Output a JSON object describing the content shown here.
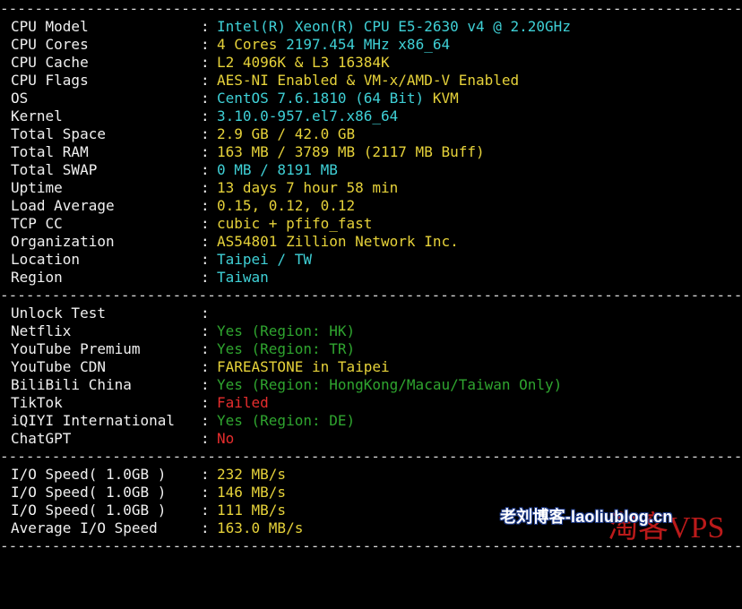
{
  "separator": "----------------------------------------------------------------------------------------------------------",
  "system_info": [
    {
      "key": "CPU Model",
      "value": "Intel(R) Xeon(R) CPU E5-2630 v4 @ 2.20GHz",
      "color": "#3fd0d6"
    },
    {
      "key": "CPU Cores",
      "value": "4 Cores 2197.454 MHz x86_64",
      "color": "#e6d23a",
      "value2": " 2197.454 MHz x86_64",
      "color2": "#3fd0d6"
    },
    {
      "key": "CPU Cache",
      "value": "L2 4096K & L3 16384K",
      "color": "#e6d23a"
    },
    {
      "key": "CPU Flags",
      "value": "AES-NI Enabled & VM-x/AMD-V Enabled",
      "color": "#e6d23a"
    },
    {
      "key": "OS",
      "value": "CentOS 7.6.1810 (64 Bit) KVM",
      "color": "#3fd0d6"
    },
    {
      "key": "Kernel",
      "value": "3.10.0-957.el7.x86_64",
      "color": "#3fd0d6"
    },
    {
      "key": "Total Space",
      "value": "2.9 GB / 42.0 GB",
      "color": "#e6d23a"
    },
    {
      "key": "Total RAM",
      "value": "163 MB / 3789 MB (2117 MB Buff)",
      "color": "#e6d23a"
    },
    {
      "key": "Total SWAP",
      "value": "0 MB / 8191 MB",
      "color": "#3fd0d6"
    },
    {
      "key": "Uptime",
      "value": "13 days 7 hour 58 min",
      "color": "#e6d23a"
    },
    {
      "key": "Load Average",
      "value": "0.15, 0.12, 0.12",
      "color": "#e6d23a"
    },
    {
      "key": "TCP CC",
      "value": "cubic + pfifo_fast",
      "color": "#e6d23a"
    },
    {
      "key": "Organization",
      "value": "AS54801 Zillion Network Inc.",
      "color": "#e6d23a"
    },
    {
      "key": "Location",
      "value": "Taipei / TW",
      "color": "#3fd0d6"
    },
    {
      "key": "Region",
      "value": "Taiwan",
      "color": "#3fd0d6"
    }
  ],
  "unlock_test": [
    {
      "key": "Unlock Test",
      "value": "",
      "color": "#f0f0f0"
    },
    {
      "key": "Netflix",
      "value": "Yes (Region: HK)",
      "color": "#2fa52f"
    },
    {
      "key": "YouTube Premium",
      "value": "Yes (Region: TR)",
      "color": "#2fa52f"
    },
    {
      "key": "YouTube CDN",
      "value": "FAREASTONE in Taipei",
      "color": "#e6d23a"
    },
    {
      "key": "BiliBili China",
      "value": "Yes (Region: HongKong/Macau/Taiwan Only)",
      "color": "#2fa52f"
    },
    {
      "key": "TikTok",
      "value": "Failed",
      "color": "#e62d2d"
    },
    {
      "key": "iQIYI International",
      "value": "Yes (Region: DE)",
      "color": "#2fa52f"
    },
    {
      "key": "ChatGPT",
      "value": "No",
      "color": "#e62d2d"
    }
  ],
  "io_speed": [
    {
      "key": "I/O Speed( 1.0GB )",
      "value": "232 MB/s",
      "color": "#e6d23a"
    },
    {
      "key": "I/O Speed( 1.0GB )",
      "value": "146 MB/s",
      "color": "#e6d23a"
    },
    {
      "key": "I/O Speed( 1.0GB )",
      "value": "111 MB/s",
      "color": "#e6d23a"
    },
    {
      "key": "Average I/O Speed",
      "value": "163.0 MB/s",
      "color": "#e6d23a"
    }
  ],
  "watermark": {
    "text1": "老刘博客-laoliublog.cn",
    "text2": "淘客VPS"
  }
}
